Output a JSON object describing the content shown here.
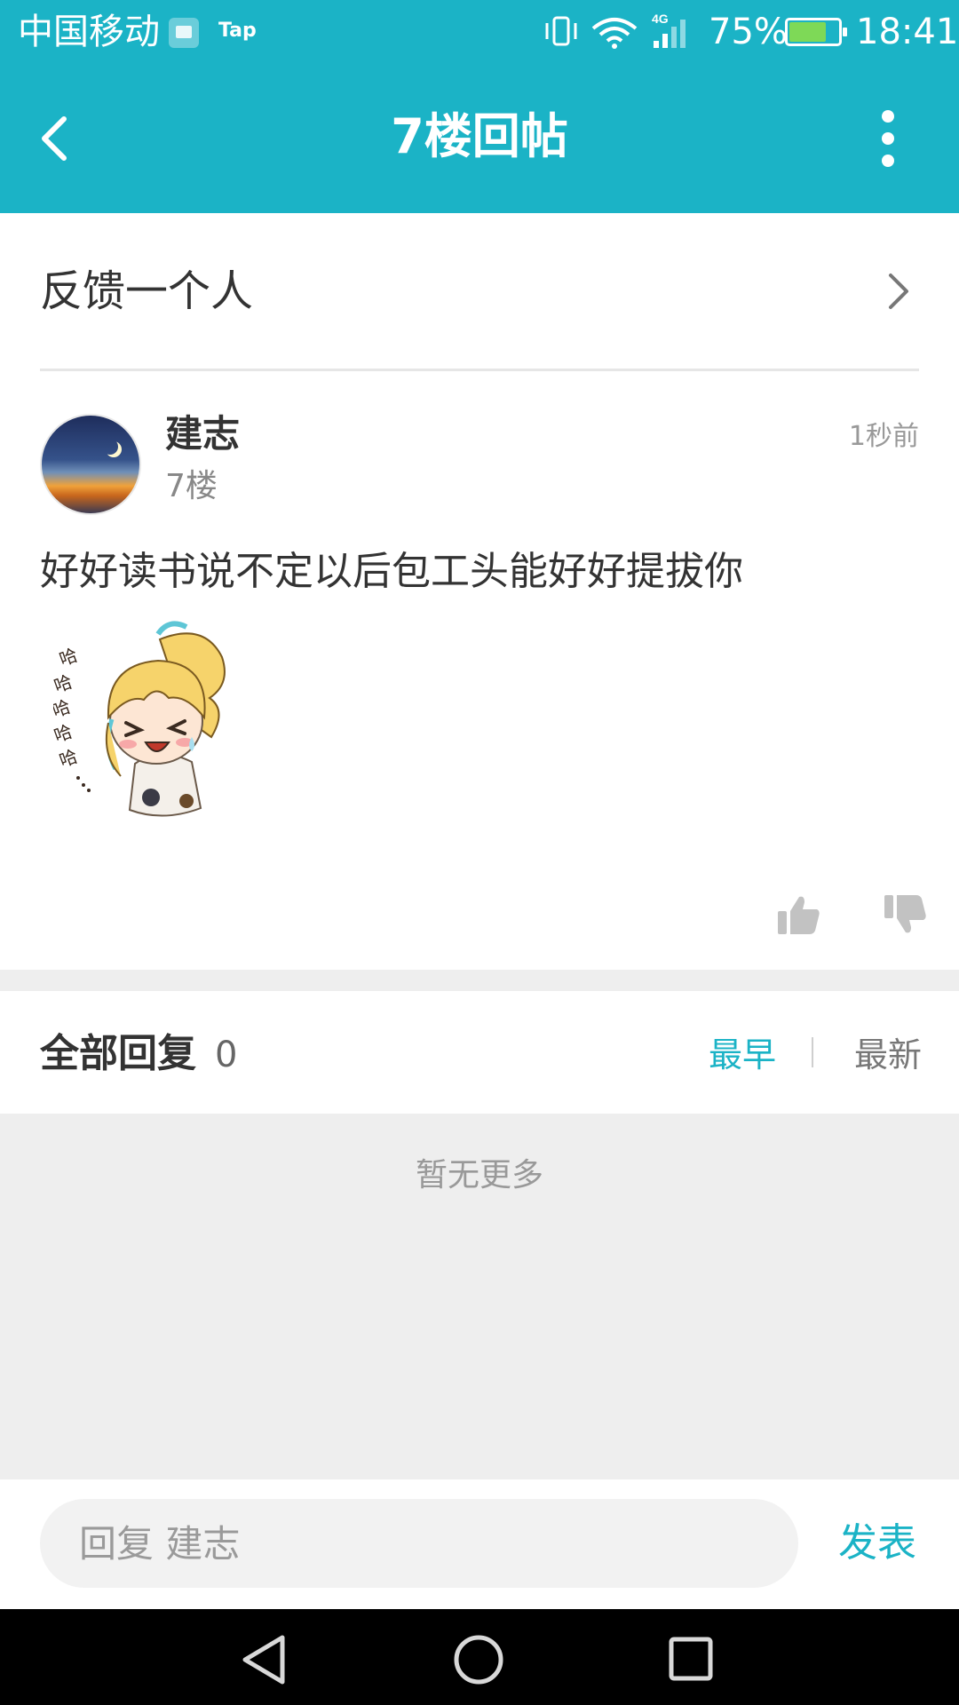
{
  "status_bar": {
    "carrier": "中国移动",
    "tap_label": "Tap",
    "network": "4G",
    "battery_percent": "75%",
    "battery_level": 0.75,
    "time": "18:41"
  },
  "header": {
    "title": "7楼回帖",
    "back_icon": "back-arrow-icon",
    "more_icon": "more-vertical-icon"
  },
  "feedback": {
    "label": "反馈一个人"
  },
  "post": {
    "author": "建志",
    "floor": "7楼",
    "time": "1秒前",
    "content": "好好读书说不定以后包工头能好好提拔你",
    "sticker": "laughing-anime-girl-sticker",
    "sticker_text": "哈哈哈哈哈..."
  },
  "replies": {
    "title": "全部回复",
    "count": "0",
    "sort_earliest": "最早",
    "sort_latest": "最新",
    "empty_text": "暂无更多"
  },
  "reply_bar": {
    "placeholder": "回复 建志",
    "send_label": "发表"
  },
  "colors": {
    "accent": "#1bb3c6",
    "background_gray": "#eeeeee"
  }
}
